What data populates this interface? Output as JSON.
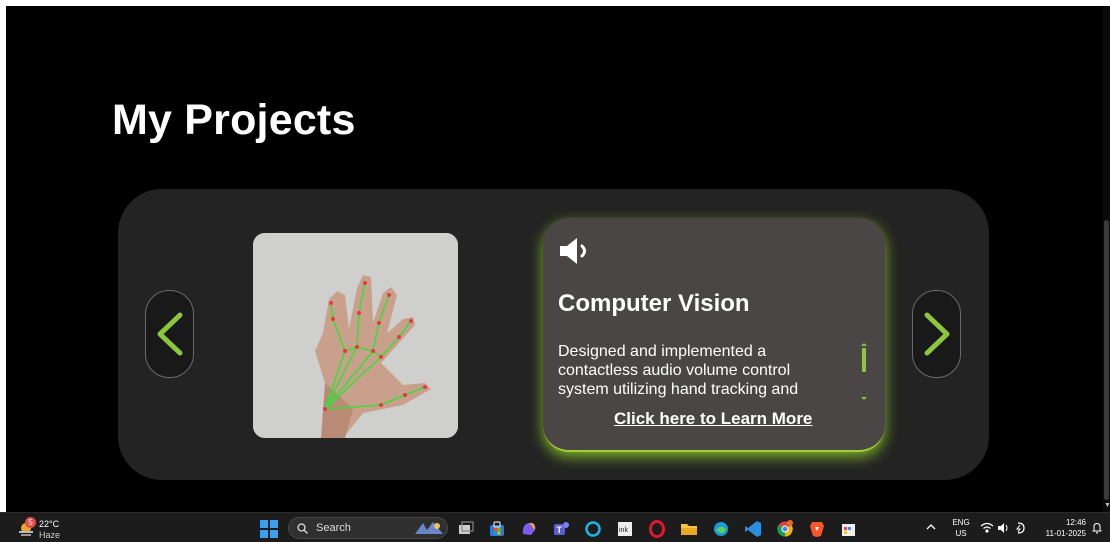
{
  "page": {
    "title": "My Projects"
  },
  "carousel": {
    "prev_label": "previous",
    "next_label": "next",
    "card": {
      "icon": "speaker-icon",
      "title": "Computer Vision",
      "description": "Designed and implemented a contactless audio volume control system utilizing hand tracking and",
      "link_text": "Click here to Learn More"
    }
  },
  "taskbar": {
    "weather": {
      "badge": "5",
      "temperature": "22°C",
      "condition": "Haze"
    },
    "search_placeholder": "Search",
    "apps": [
      "task-view-icon",
      "store-icon",
      "copilot-icon",
      "teams-icon",
      "cortana-icon",
      "ink-icon",
      "opera-icon",
      "file-explorer-icon",
      "edge-icon",
      "vscode-icon",
      "chrome-icon",
      "brave-icon",
      "paint-icon"
    ],
    "language": {
      "line1": "ENG",
      "line2": "US"
    },
    "clock": {
      "time": "12:46",
      "date": "11-01-2025"
    }
  },
  "colors": {
    "accent": "#8cc63f",
    "card_bg": "#4a4645",
    "carousel_bg": "#232323"
  }
}
